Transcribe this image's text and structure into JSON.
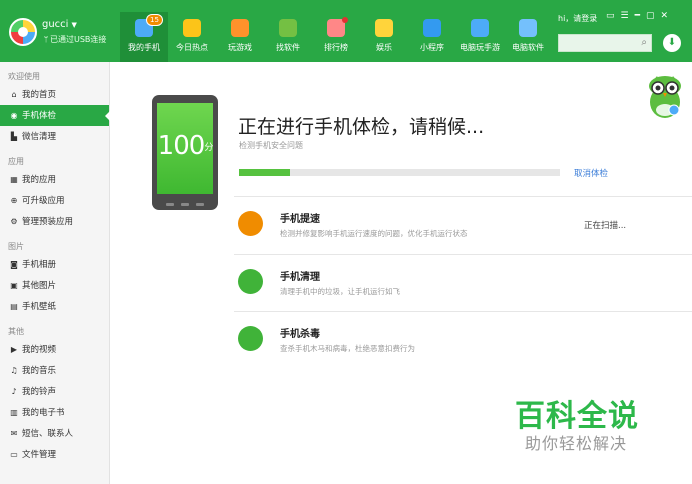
{
  "header": {
    "username": "gucci",
    "usb_status": "已通过USB连接",
    "greeting": "hi，请登录",
    "nav": [
      {
        "label": "我的手机",
        "icon": "phone-icon",
        "color": "#4dabf7",
        "badge": "15",
        "active": true
      },
      {
        "label": "今日热点",
        "icon": "star-icon",
        "color": "#fcc419",
        "badge": "",
        "active": false
      },
      {
        "label": "玩游戏",
        "icon": "gamepad-icon",
        "color": "#ff922b",
        "badge": "",
        "active": false
      },
      {
        "label": "找软件",
        "icon": "android-icon",
        "color": "#74c043",
        "badge": "",
        "active": false
      },
      {
        "label": "排行榜",
        "icon": "medal-icon",
        "color": "#ff8787",
        "badge": "",
        "active": false
      },
      {
        "label": "娱乐",
        "icon": "music-box-icon",
        "color": "#ffd43b",
        "badge": "",
        "active": false
      },
      {
        "label": "小程序",
        "icon": "mini-program-icon",
        "color": "#339af0",
        "badge": "",
        "active": false
      },
      {
        "label": "电脑玩手游",
        "icon": "monitor-game-icon",
        "color": "#4dabf7",
        "badge": "",
        "active": false
      },
      {
        "label": "电脑软件",
        "icon": "windows-icon",
        "color": "#74c0fc",
        "badge": "",
        "active": false
      }
    ],
    "search_placeholder": ""
  },
  "sidebar": {
    "sections": [
      {
        "title": "欢迎使用",
        "items": [
          {
            "label": "我的首页",
            "icon": "home-icon",
            "glyph": "⌂",
            "active": false
          },
          {
            "label": "手机体检",
            "icon": "checkup-icon",
            "glyph": "◉",
            "active": true
          },
          {
            "label": "微信清理",
            "icon": "broom-icon",
            "glyph": "▙",
            "active": false
          }
        ]
      },
      {
        "title": "应用",
        "items": [
          {
            "label": "我的应用",
            "icon": "apps-grid-icon",
            "glyph": "▦",
            "active": false
          },
          {
            "label": "可升级应用",
            "icon": "upgrade-icon",
            "glyph": "⊕",
            "active": false
          },
          {
            "label": "管理预装应用",
            "icon": "gear-icon",
            "glyph": "⚙",
            "active": false
          }
        ]
      },
      {
        "title": "图片",
        "items": [
          {
            "label": "手机相册",
            "icon": "camera-icon",
            "glyph": "◙",
            "active": false
          },
          {
            "label": "其他图片",
            "icon": "image-icon",
            "glyph": "▣",
            "active": false
          },
          {
            "label": "手机壁纸",
            "icon": "wallpaper-icon",
            "glyph": "▤",
            "active": false
          }
        ]
      },
      {
        "title": "其他",
        "items": [
          {
            "label": "我的视频",
            "icon": "video-icon",
            "glyph": "▶",
            "active": false
          },
          {
            "label": "我的音乐",
            "icon": "music-icon",
            "glyph": "♫",
            "active": false
          },
          {
            "label": "我的铃声",
            "icon": "bell-icon",
            "glyph": "♪",
            "active": false
          },
          {
            "label": "我的电子书",
            "icon": "book-icon",
            "glyph": "▥",
            "active": false
          },
          {
            "label": "短信、联系人",
            "icon": "message-icon",
            "glyph": "✉",
            "active": false
          },
          {
            "label": "文件管理",
            "icon": "folder-icon",
            "glyph": "▭",
            "active": false
          }
        ]
      }
    ]
  },
  "main": {
    "score": "100",
    "score_unit": "分",
    "title": "正在进行手机体检，请稍候...",
    "subtitle": "检测手机安全问题",
    "progress": 0.16,
    "cancel_label": "取消体检",
    "checks": [
      {
        "title": "手机提速",
        "desc": "检测并修复影响手机运行速度的问题，优化手机运行状态",
        "status": "正在扫描...",
        "icon": "speedup-icon",
        "color": "#f08c00"
      },
      {
        "title": "手机清理",
        "desc": "清理手机中的垃圾，让手机运行如飞",
        "status": "",
        "icon": "broom-icon",
        "color": "#40b339"
      },
      {
        "title": "手机杀毒",
        "desc": "查杀手机木马和病毒，杜绝恶意扣费行为",
        "status": "",
        "icon": "shield-icon",
        "color": "#40b339"
      }
    ]
  },
  "watermark": {
    "big": "百科全说",
    "small": "助你轻松解决"
  }
}
